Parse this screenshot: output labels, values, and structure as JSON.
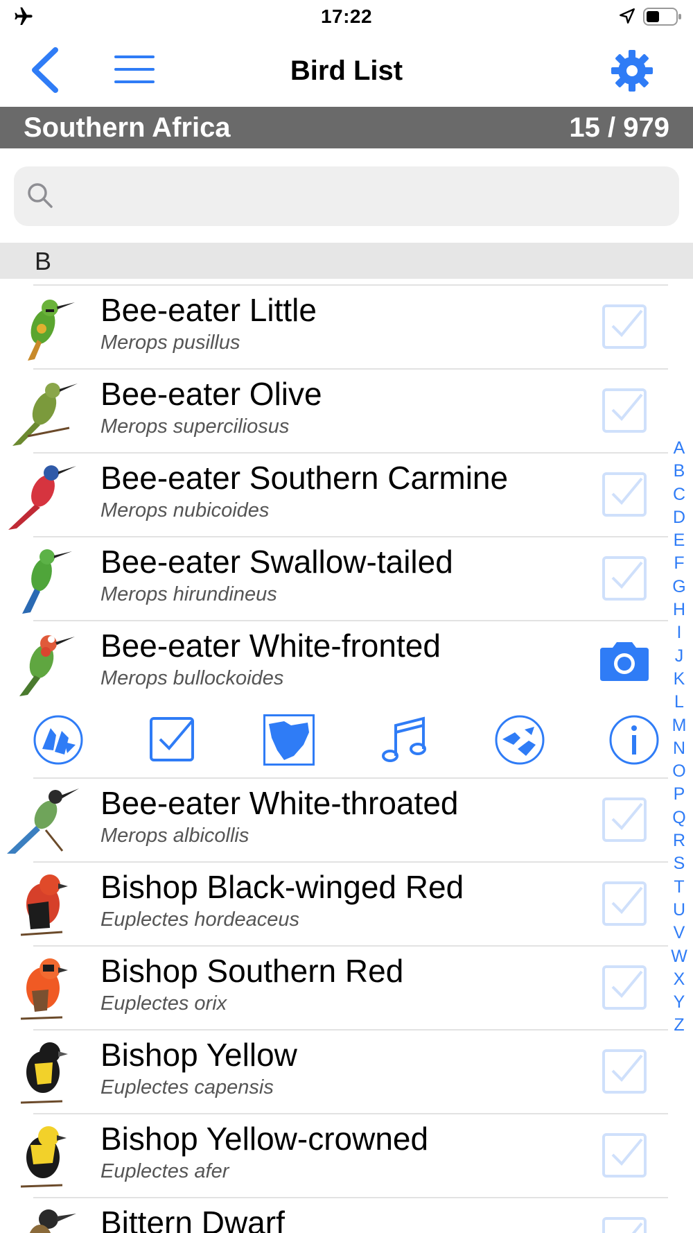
{
  "status_bar": {
    "time": "17:22",
    "airplane_icon": "airplane-icon",
    "location_icon": "location-arrow-icon",
    "battery_icon": "battery-icon"
  },
  "nav": {
    "title": "Bird List",
    "back_icon": "chevron-left-icon",
    "menu_icon": "hamburger-menu-icon",
    "settings_icon": "gear-icon"
  },
  "region": {
    "name": "Southern Africa",
    "count": "15 / 979"
  },
  "search": {
    "placeholder": "",
    "value": ""
  },
  "section": {
    "letter": "B"
  },
  "birds": [
    {
      "common": "Bee-eater Little",
      "scientific": "Merops pusillus"
    },
    {
      "common": "Bee-eater Olive",
      "scientific": "Merops superciliosus"
    },
    {
      "common": "Bee-eater Southern Carmine",
      "scientific": "Merops nubicoides"
    },
    {
      "common": "Bee-eater Swallow-tailed",
      "scientific": "Merops hirundineus"
    },
    {
      "common": "Bee-eater White-fronted",
      "scientific": "Merops bullockoides"
    },
    {
      "common": "Bee-eater White-throated",
      "scientific": "Merops albicollis"
    },
    {
      "common": "Bishop Black-winged Red",
      "scientific": "Euplectes hordeaceus"
    },
    {
      "common": "Bishop Southern Red",
      "scientific": "Euplectes orix"
    },
    {
      "common": "Bishop Yellow",
      "scientific": "Euplectes capensis"
    },
    {
      "common": "Bishop Yellow-crowned",
      "scientific": "Euplectes afer"
    },
    {
      "common": "Bittern Dwarf",
      "scientific": ""
    }
  ],
  "action_bar": {
    "items": [
      "compare-birds-icon",
      "checkbox-icon",
      "region-map-icon",
      "music-note-icon",
      "similar-birds-icon",
      "info-icon"
    ]
  },
  "index": [
    "A",
    "B",
    "C",
    "D",
    "E",
    "F",
    "G",
    "H",
    "I",
    "J",
    "K",
    "L",
    "M",
    "N",
    "O",
    "P",
    "Q",
    "R",
    "S",
    "T",
    "U",
    "V",
    "W",
    "X",
    "Y",
    "Z"
  ],
  "colors": {
    "accent": "#2f7cf6",
    "region_bar": "#6a6a6a",
    "check_faded": "#cfe0fb",
    "section_bg": "#e6e6e6",
    "search_bg": "#efefef"
  }
}
